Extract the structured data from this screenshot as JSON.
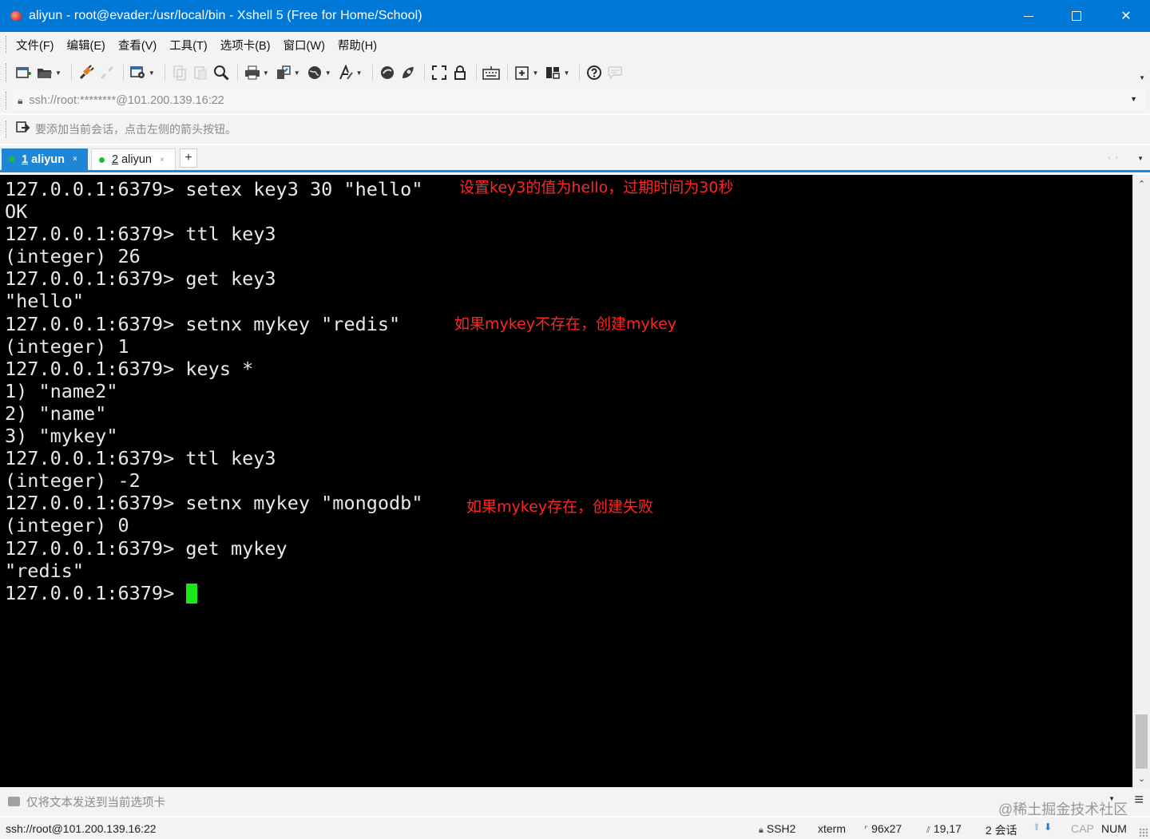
{
  "window": {
    "title": "aliyun - root@evader:/usr/local/bin - Xshell 5 (Free for Home/School)"
  },
  "menu": [
    "文件(F)",
    "编辑(E)",
    "查看(V)",
    "工具(T)",
    "选项卡(B)",
    "窗口(W)",
    "帮助(H)"
  ],
  "address": {
    "url": "ssh://root:********@101.200.139.16:22"
  },
  "hint": {
    "text": "要添加当前会话，点击左侧的箭头按钮。"
  },
  "tabs": [
    {
      "number": "1",
      "label": "aliyun",
      "active": true
    },
    {
      "number": "2",
      "label": "aliyun",
      "active": false
    }
  ],
  "terminal": {
    "lines": [
      "127.0.0.1:6379> setex key3 30 \"hello\"",
      "OK",
      "127.0.0.1:6379> ttl key3",
      "(integer) 26",
      "127.0.0.1:6379> get key3",
      "\"hello\"",
      "127.0.0.1:6379> setnx mykey \"redis\"",
      "(integer) 1",
      "127.0.0.1:6379> keys *",
      "1) \"name2\"",
      "2) \"name\"",
      "3) \"mykey\"",
      "127.0.0.1:6379> ttl key3",
      "(integer) -2",
      "127.0.0.1:6379> setnx mykey \"mongodb\"",
      "(integer) 0",
      "127.0.0.1:6379> get mykey",
      "\"redis\""
    ],
    "prompt": "127.0.0.1:6379> ",
    "cursor_color": "#17e617",
    "annotations": {
      "setex": "设置key3的值为hello，过期时间为30秒",
      "setnx_new": "如果mykey不存在，创建mykey",
      "setnx_exists": "如果mykey存在，创建失败"
    },
    "annotation_color": "#ff2525"
  },
  "compose": {
    "text": "仅将文本发送到当前选项卡"
  },
  "watermark": "@稀土掘金技术社区",
  "status": {
    "connection": "ssh://root@101.200.139.16:22",
    "protocol": "SSH2",
    "terminal_type": "xterm",
    "size": "96x27",
    "cursor_pos": "19,17",
    "sessions": "2 会话",
    "cap": "CAP",
    "num": "NUM"
  },
  "colors": {
    "titlebar": "#0078d7",
    "tab_active": "#1f86d6",
    "terminal_bg": "#000000",
    "terminal_fg": "#e8e8e8"
  }
}
